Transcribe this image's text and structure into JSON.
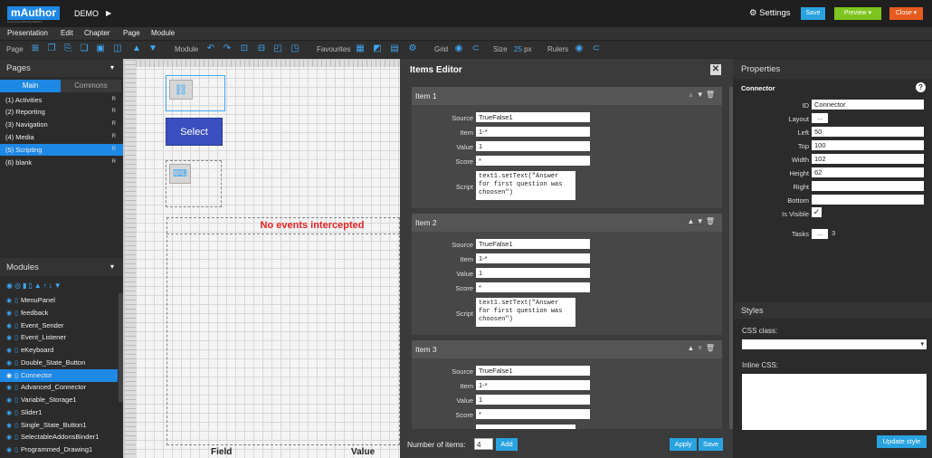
{
  "app": {
    "logo": "mAuthor",
    "logo_sub": "eLearning Authoring Platform",
    "project": "DEMO",
    "project_arrow": "▶",
    "settings": "Settings",
    "settings_icon": "gear-icon",
    "save": "Save",
    "preview": "Preview",
    "preview_caret": "▾",
    "close": "Close",
    "close_caret": "▾"
  },
  "menu": [
    "Presentation",
    "Edit",
    "Chapter",
    "Page",
    "Module"
  ],
  "toolbar": {
    "page": "Page",
    "module": "Module",
    "favourites": "Favourites",
    "grid": "Grid",
    "size": "Size",
    "size_value": "25",
    "size_unit": "px",
    "rulers": "Rulers"
  },
  "pages": {
    "title": "Pages",
    "caret": "▾",
    "tab_main": "Main",
    "tab_commons": "Commons",
    "items": [
      {
        "label": "(1) Activities",
        "flag": "R"
      },
      {
        "label": "(2) Reporting",
        "flag": "R"
      },
      {
        "label": "(3) Navigation",
        "flag": "R"
      },
      {
        "label": "(4) Media",
        "flag": "R"
      },
      {
        "label": "(5) Scripting",
        "flag": "R"
      },
      {
        "label": "(6) blank",
        "flag": "R"
      }
    ]
  },
  "modules": {
    "title": "Modules",
    "caret": "▾",
    "items": [
      "MenuPanel",
      "feedback",
      "Event_Sender",
      "Event_Listener",
      "eKeyboard",
      "Double_State_Button",
      "Connector",
      "Advanced_Connector",
      "Variable_Storage1",
      "Slider1",
      "Single_State_Button1",
      "SelectableAddonsBinder1",
      "Programmed_Drawing1"
    ]
  },
  "canvas": {
    "select_button": "Select",
    "events_text": "No events intercepted",
    "field_header": "Field",
    "value_header": "Value"
  },
  "items_editor": {
    "title": "Items Editor",
    "close": "✕",
    "labels": {
      "source": "Source",
      "item": "Item",
      "value": "Value",
      "score": "Score",
      "script": "Script"
    },
    "items": [
      {
        "title": "Item 1",
        "source": "TrueFalse1",
        "item": "1-*",
        "value": "1",
        "score": "*",
        "script": "text1.setText(\"Answer\nfor first question was\nchoosen\")"
      },
      {
        "title": "Item 2",
        "source": "TrueFalse1",
        "item": "1-*",
        "value": "1",
        "score": "*",
        "script": "text1.setText(\"Answer\nfor first question was\nchoosen\")"
      },
      {
        "title": "Item 3",
        "source": "TrueFalse1",
        "item": "1-*",
        "value": "1",
        "score": "*",
        "script": ""
      }
    ],
    "number_label": "Number of items:",
    "number_value": "4",
    "add": "Add",
    "apply": "Apply",
    "save": "Save"
  },
  "properties": {
    "title": "Properties",
    "subtitle": "Connector",
    "help": "?",
    "id_label": "ID",
    "id": "Connector",
    "layout_label": "Layout",
    "layout": "...",
    "left_label": "Left",
    "left": "50",
    "top_label": "Top",
    "top": "100",
    "width_label": "Width",
    "width": "102",
    "height_label": "Height",
    "height": "62",
    "right_label": "Right",
    "right": "",
    "bottom_label": "Bottom",
    "bottom": "",
    "visible_label": "Is Visible",
    "visible_mark": "✓",
    "tasks_label": "Tasks",
    "tasks_button": "...",
    "tasks_count": "3"
  },
  "styles": {
    "title": "Styles",
    "css_class_label": "CSS class:",
    "css_class_value": "",
    "css_caret": "▾",
    "inline_css_label": "Inline CSS:",
    "inline_css_value": "",
    "update": "Update style"
  }
}
